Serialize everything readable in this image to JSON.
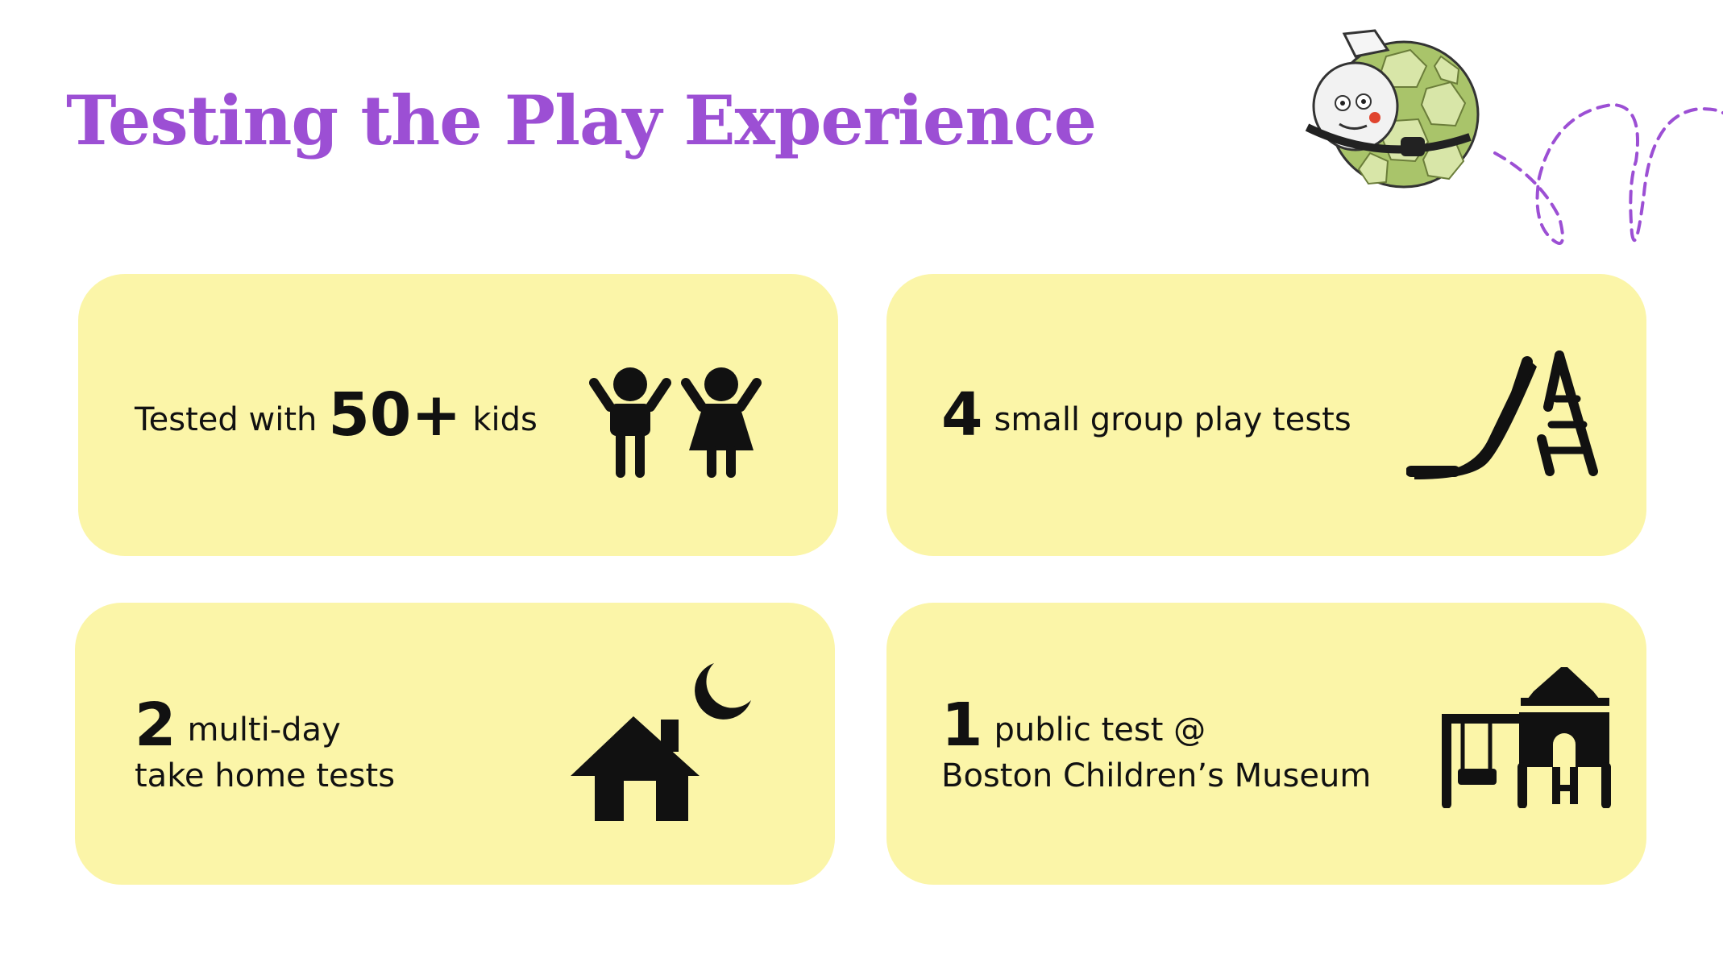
{
  "title": "Testing the Play Experience",
  "colors": {
    "title": "#9c4fd4",
    "card": "#fbf5a8",
    "icon": "#111111",
    "accent_dashes": "#9c4fd4"
  },
  "cards": [
    {
      "prefix": "Tested with",
      "number": "50+",
      "suffix": "kids",
      "icon": "kids-icon"
    },
    {
      "number": "4",
      "text": "small group play tests",
      "icon": "slide-icon"
    },
    {
      "number": "2",
      "text": "multi-day",
      "line2": "take home tests",
      "icon": "house-moon-icon"
    },
    {
      "number": "1",
      "text": "public test @",
      "line2": "Boston Children’s Museum",
      "icon": "playground-icon"
    }
  ],
  "decorations": {
    "mascot": "turtle-mascot-illustration",
    "swirl": "dashed-loop-line"
  }
}
